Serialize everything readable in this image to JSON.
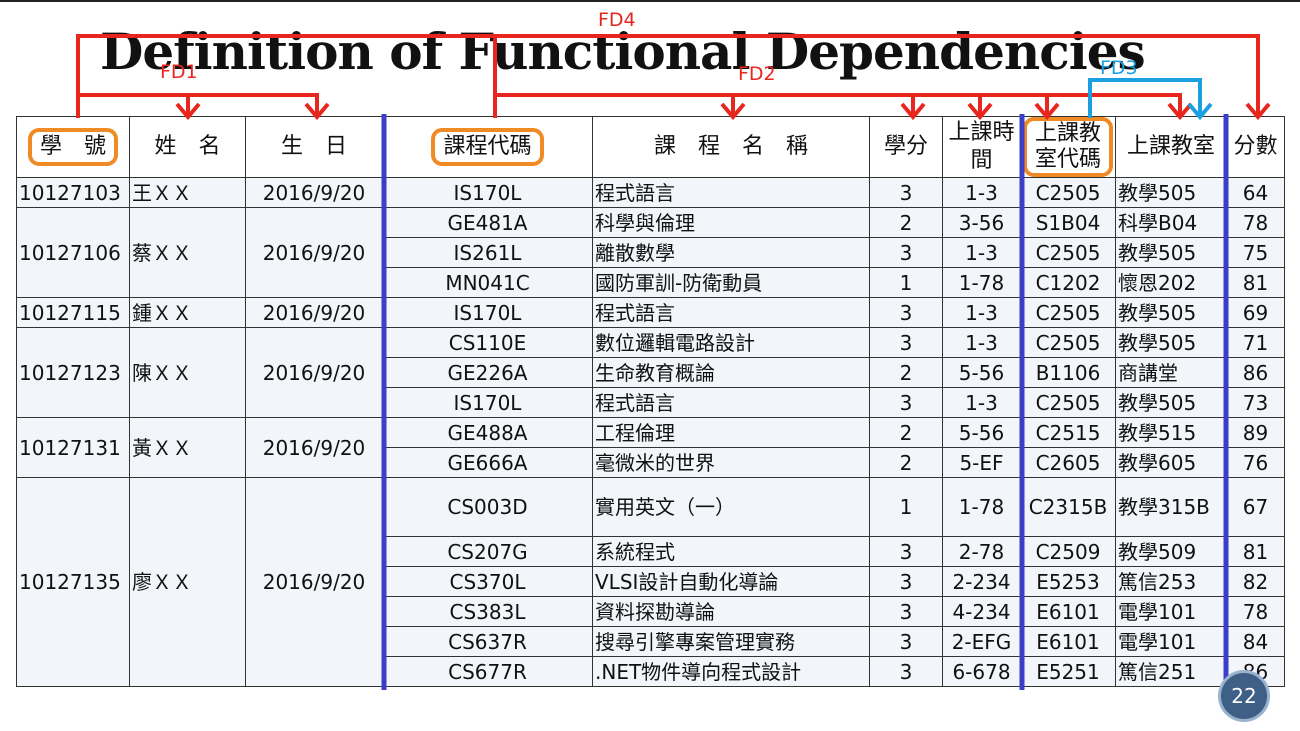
{
  "title": "Definition of Functional Dependencies",
  "fd_labels": {
    "fd1": "FD1",
    "fd2": "FD2",
    "fd3": "FD3",
    "fd4": "FD4"
  },
  "colors": {
    "fd_arrow": "#e8261e",
    "fd3_arrow": "#1aa0e0",
    "key_highlight": "#f08a24",
    "divider": "#3a3fc9"
  },
  "headers": {
    "student_id": "學　號",
    "name": "姓　名",
    "birthday": "生　日",
    "course_code": "課程代碼",
    "course_name": "課　程　名　稱",
    "credits": "學分",
    "time": "上課時間",
    "room_code": "上課教室代碼",
    "room": "上課教室",
    "score": "分數"
  },
  "students": [
    {
      "id": "10127103",
      "name": "王ＸＸ",
      "birthday": "2016/9/20",
      "courses": [
        {
          "code": "IS170L",
          "name": "程式語言",
          "credits": "3",
          "time": "1-3",
          "room_code": "C2505",
          "room": "教學505",
          "score": "64"
        }
      ]
    },
    {
      "id": "10127106",
      "name": "蔡ＸＸ",
      "birthday": "2016/9/20",
      "courses": [
        {
          "code": "GE481A",
          "name": "科學與倫理",
          "credits": "2",
          "time": "3-56",
          "room_code": "S1B04",
          "room": "科學B04",
          "score": "78"
        },
        {
          "code": "IS261L",
          "name": "離散數學",
          "credits": "3",
          "time": "1-3",
          "room_code": "C2505",
          "room": "教學505",
          "score": "75"
        },
        {
          "code": "MN041C",
          "name": "國防軍訓-防衛動員",
          "credits": "1",
          "time": "1-78",
          "room_code": "C1202",
          "room": "懷恩202",
          "score": "81"
        }
      ]
    },
    {
      "id": "10127115",
      "name": "鍾ＸＸ",
      "birthday": "2016/9/20",
      "courses": [
        {
          "code": "IS170L",
          "name": "程式語言",
          "credits": "3",
          "time": "1-3",
          "room_code": "C2505",
          "room": "教學505",
          "score": "69"
        }
      ]
    },
    {
      "id": "10127123",
      "name": "陳ＸＸ",
      "birthday": "2016/9/20",
      "courses": [
        {
          "code": "CS110E",
          "name": "數位邏輯電路設計",
          "credits": "3",
          "time": "1-3",
          "room_code": "C2505",
          "room": "教學505",
          "score": "71"
        },
        {
          "code": "GE226A",
          "name": "生命教育概論",
          "credits": "2",
          "time": "5-56",
          "room_code": "B1106",
          "room": "商講堂",
          "score": "86"
        },
        {
          "code": "IS170L",
          "name": "程式語言",
          "credits": "3",
          "time": "1-3",
          "room_code": "C2505",
          "room": "教學505",
          "score": "73"
        }
      ]
    },
    {
      "id": "10127131",
      "name": "黃ＸＸ",
      "birthday": "2016/9/20",
      "courses": [
        {
          "code": "GE488A",
          "name": "工程倫理",
          "credits": "2",
          "time": "5-56",
          "room_code": "C2515",
          "room": "教學515",
          "score": "89"
        },
        {
          "code": "GE666A",
          "name": "毫微米的世界",
          "credits": "2",
          "time": "5-EF",
          "room_code": "C2605",
          "room": "教學605",
          "score": "76"
        }
      ]
    },
    {
      "id": "10127135",
      "name": "廖ＸＸ",
      "birthday": "2016/9/20",
      "courses": [
        {
          "code": "CS003D",
          "name": "實用英文（一）",
          "credits": "1",
          "time": "1-78",
          "room_code": "C2315B",
          "room": "教學315B",
          "score": "67",
          "tall": true
        },
        {
          "code": "CS207G",
          "name": "系統程式",
          "credits": "3",
          "time": "2-78",
          "room_code": "C2509",
          "room": "教學509",
          "score": "81"
        },
        {
          "code": "CS370L",
          "name": "VLSI設計自動化導論",
          "credits": "3",
          "time": "2-234",
          "room_code": "E5253",
          "room": "篤信253",
          "score": "82"
        },
        {
          "code": "CS383L",
          "name": "資料探勘導論",
          "credits": "3",
          "time": "4-234",
          "room_code": "E6101",
          "room": "電學101",
          "score": "78"
        },
        {
          "code": "CS637R",
          "name": "搜尋引擎專案管理實務",
          "credits": "3",
          "time": "2-EFG",
          "room_code": "E6101",
          "room": "電學101",
          "score": "84"
        },
        {
          "code": "CS677R",
          "name": ".NET物件導向程式設計",
          "credits": "3",
          "time": "6-678",
          "room_code": "E5251",
          "room": "篤信251",
          "score": "86"
        }
      ]
    }
  ],
  "page_number": "22"
}
